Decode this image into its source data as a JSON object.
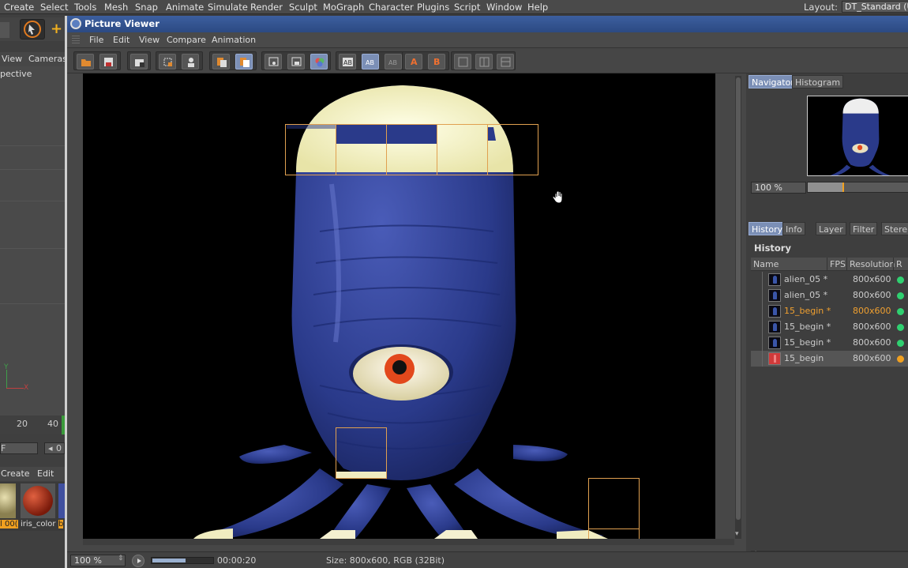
{
  "menubar": {
    "items": [
      "Create",
      "Select",
      "Tools",
      "Mesh",
      "Snap",
      "Animate",
      "Simulate",
      "Render",
      "Sculpt",
      "MoGraph",
      "Character",
      "Plugins",
      "Script",
      "Window",
      "Help"
    ],
    "layout_label": "Layout:",
    "layout_value": "DT_Standard (U"
  },
  "left": {
    "view_tab": "View",
    "cameras_tab": "Cameras",
    "viewport_label": "pective",
    "ruler_20": "20",
    "ruler_40": "40",
    "frame_field": "F",
    "stepper": "0",
    "mat_create": "Create",
    "mat_edit": "Edit",
    "mat_1_label": "l 00(",
    "mat_2_label": "iris_color",
    "mat_3_label": "b",
    "axis_y": "Y",
    "axis_x": "X"
  },
  "picture_viewer": {
    "title": "Picture Viewer",
    "menu": [
      "File",
      "Edit",
      "View",
      "Compare",
      "Animation"
    ],
    "status": {
      "zoom": "100 %",
      "progress": 0.55,
      "timecode": "00:00:20",
      "size_info": "Size: 800x600, RGB (32Bit)"
    }
  },
  "right": {
    "tabs_top": [
      "Navigator",
      "Histogram"
    ],
    "nav_zoom": "100 %",
    "tabs_bottom": [
      "History",
      "Info",
      "Layer",
      "Filter",
      "Stere"
    ],
    "history_title": "History",
    "history_columns": [
      "Name",
      "FPS",
      "Resolution",
      "R"
    ],
    "history_rows": [
      {
        "name": "alien_05 *",
        "res": "800x600",
        "dot": "#2fd070"
      },
      {
        "name": "alien_05 *",
        "res": "800x600",
        "dot": "#2fd070"
      },
      {
        "name": "15_begin *",
        "res": "800x600",
        "dot": "#2fd070"
      },
      {
        "name": "15_begin *",
        "res": "800x600",
        "dot": "#2fd070"
      },
      {
        "name": "15_begin *",
        "res": "800x600",
        "dot": "#2fd070"
      },
      {
        "name": "15_begin",
        "res": "800x600",
        "dot": "#f0a020"
      }
    ]
  },
  "colors": {
    "accent": "#7b8fb6",
    "title_bar": "#2c4a82",
    "active_orange": "#f0a030",
    "render_box": "#e0a050"
  }
}
